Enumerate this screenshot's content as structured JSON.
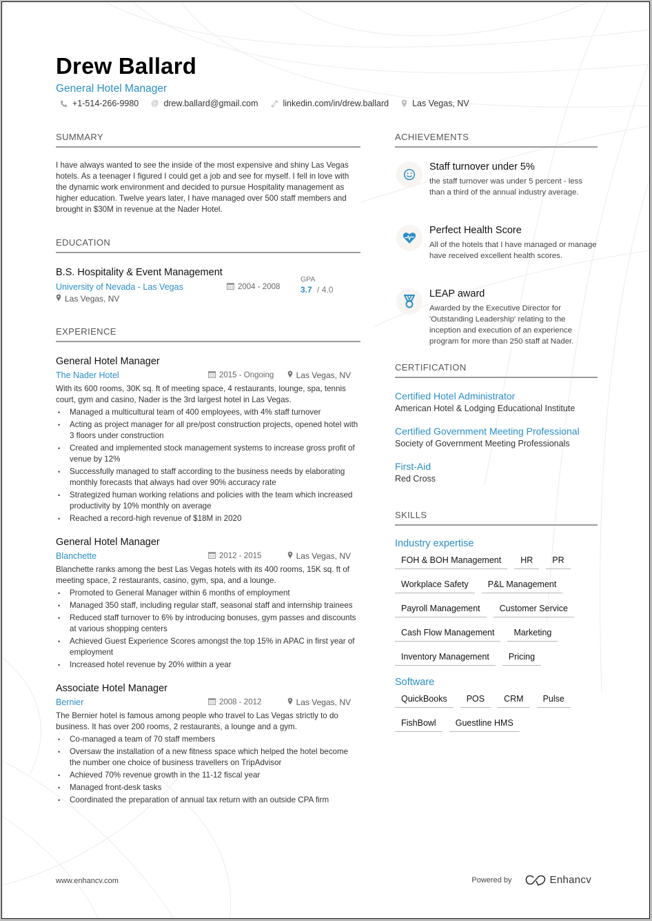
{
  "header": {
    "name": "Drew Ballard",
    "title": "General Hotel Manager",
    "contacts": [
      {
        "icon": "phone-icon",
        "text": "+1-514-266-9980"
      },
      {
        "icon": "at-icon",
        "text": "drew.ballard@gmail.com"
      },
      {
        "icon": "link-icon",
        "text": "linkedin.com/in/drew.ballard"
      },
      {
        "icon": "location-pin-icon",
        "text": "Las Vegas, NV"
      }
    ]
  },
  "colors": {
    "accent": "#2a8fc7",
    "text": "#222222",
    "section_rule": "#9a9a9a"
  },
  "summary": {
    "heading": "SUMMARY",
    "text": "I have always wanted to see the inside of the most expensive and shiny Las Vegas hotels. As a teenager I figured I could get a job and see for myself. I fell in love with the dynamic work environment and decided to pursue Hospitality management as higher education. Twelve years later, I have managed over 500 staff members and brought in $30M in revenue at the Nader Hotel."
  },
  "education": {
    "heading": "EDUCATION",
    "items": [
      {
        "degree": "B.S. Hospitality & Event Management",
        "school": "University of Nevada - Las Vegas",
        "dates": "2004 - 2008",
        "location": "Las Vegas, NV",
        "gpa_label": "GPA",
        "gpa_value": "3.7",
        "gpa_max": "4.0"
      }
    ]
  },
  "experience": {
    "heading": "EXPERIENCE",
    "jobs": [
      {
        "title": "General Hotel Manager",
        "company": "The Nader Hotel",
        "dates": "2015 - Ongoing",
        "location": "Las Vegas, NV",
        "description": "With its 600 rooms, 30K sq. ft of meeting space, 4 restaurants, lounge, spa, tennis court, gym and casino, Nader is the 3rd largest hotel in Las Vegas.",
        "bullets": [
          "Managed a multicultural team of 400 employees, with 4% staff turnover",
          "Acting as project manager for all pre/post construction projects, opened hotel with 3 floors under construction",
          "Created and implemented stock management systems to increase gross profit of venue by 12%",
          "Successfully managed to staff according to the business needs by elaborating monthly forecasts that always had over 90% accuracy rate",
          "Strategized human working relations and policies with the team which increased productivity by 10% monthly on average",
          "Reached a record-high revenue of $18M in 2020"
        ]
      },
      {
        "title": "General Hotel Manager",
        "company": "Blanchette",
        "dates": "2012 - 2015",
        "location": "Las Vegas, NV",
        "description": "Blanchette ranks among the best Las Vegas hotels with its 400 rooms, 15K sq. ft of meeting space, 2 restaurants, casino, gym, spa, and a lounge.",
        "bullets": [
          "Promoted to General Manager within 6 months of employment",
          "Managed 350 staff, including regular staff, seasonal staff and internship trainees",
          "Reduced staff turnover to 6% by introducing bonuses, gym passes and discounts at various shopping centers",
          "Achieved Guest Experience Scores amongst the top 15% in APAC in first year of employment",
          "Increased hotel revenue by 20% within a year"
        ]
      },
      {
        "title": "Associate Hotel Manager",
        "company": "Bernier",
        "dates": "2008 - 2012",
        "location": "Las Vegas, NV",
        "description": "The Bernier hotel is famous among people who travel to Las Vegas strictly to do business. It has over 200 rooms, 2 restaurants, a lounge and a gym.",
        "bullets": [
          "Co-managed a team of 70 staff members",
          "Oversaw the installation of a new fitness space which helped the hotel become the number one choice of business travellers on TripAdvisor",
          "Achieved 70% revenue growth in the 11-12 fiscal year",
          "Managed front-desk tasks",
          "Coordinated the preparation of annual tax return with an outside CPA firm"
        ]
      }
    ]
  },
  "achievements": {
    "heading": "ACHIEVEMENTS",
    "items": [
      {
        "icon": "smiley-icon",
        "title": "Staff turnover under 5%",
        "description": " the staff turnover was under 5 percent - less than a third of the annual industry average."
      },
      {
        "icon": "heart-pulse-icon",
        "title": "Perfect Health Score",
        "description": "All of the hotels that I have managed or manage have received excellent health scores."
      },
      {
        "icon": "medal-icon",
        "title": "LEAP award",
        "description": "Awarded by the Executive Director for 'Outstanding Leadership' relating to the inception and execution of an experience program for more than 250 staff at Nader."
      }
    ]
  },
  "certification": {
    "heading": "CERTIFICATION",
    "items": [
      {
        "title": "Certified Hotel Administrator",
        "issuer": "American Hotel & Lodging Educational Institute"
      },
      {
        "title": "Certified Government Meeting Professional",
        "issuer": "Society of Government Meeting Professionals"
      },
      {
        "title": "First-Aid",
        "issuer": "Red Cross"
      }
    ]
  },
  "skills": {
    "heading": "SKILLS",
    "groups": [
      {
        "title": "Industry expertise",
        "tags": [
          "FOH & BOH Management",
          "HR",
          "PR",
          "Workplace Safety",
          "P&L Management",
          "Payroll Management",
          "Customer Service",
          "Cash Flow Management",
          "Marketing",
          "Inventory Management",
          "Pricing"
        ]
      },
      {
        "title": "Software",
        "tags": [
          "QuickBooks",
          "POS",
          "CRM",
          "Pulse",
          "FishBowl",
          "Guestline HMS"
        ]
      }
    ]
  },
  "footer": {
    "website": "www.enhancv.com",
    "powered_by": "Powered by",
    "brand": "Enhancv"
  }
}
